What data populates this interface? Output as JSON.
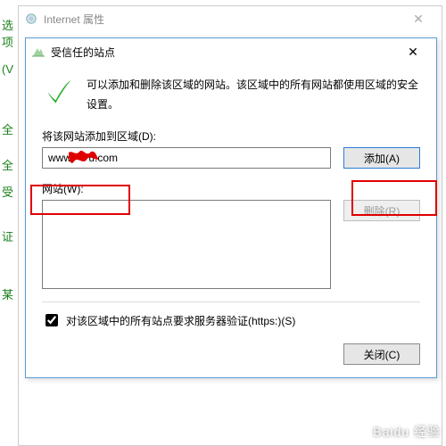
{
  "parent": {
    "title": "Internet 属性"
  },
  "dialog": {
    "title": "受信任的站点",
    "info": "可以添加和删除该区域的网站。该区域中的所有网站都使用区域的安全设置。",
    "add_field_label": "将该网站添加到区域(D):",
    "add_field_value": "www.     u.com",
    "add_button": "添加(A)",
    "list_label": "网站(W):",
    "remove_button": "删除(R)",
    "https_checkbox": "对该区域中的所有站点要求服务器验证(https:)(S)",
    "close_button": "关闭(C)"
  },
  "left_fragments": [
    "选项",
    "(V",
    "全",
    "全",
    "受",
    "证",
    "某"
  ],
  "watermark": "Baidu 经验"
}
